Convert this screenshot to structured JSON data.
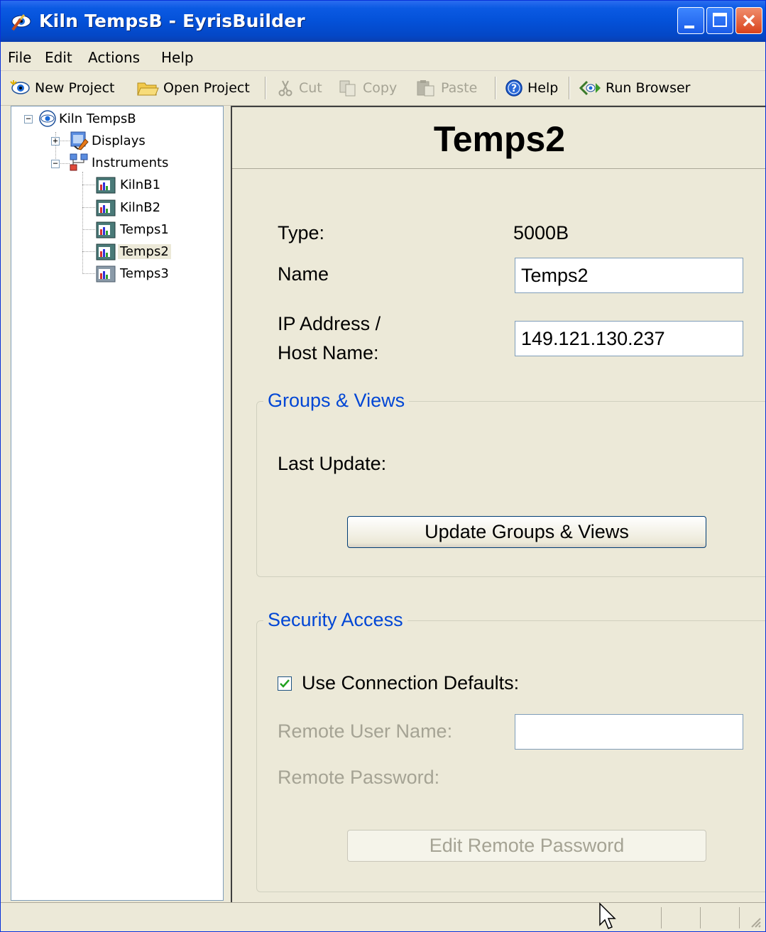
{
  "window": {
    "title": "Kiln TempsB - EyrisBuilder",
    "icon": "eyris-app-icon",
    "controls": [
      "minimize-icon",
      "maximize-icon",
      "close-icon"
    ]
  },
  "menu": {
    "file": "File",
    "edit": "Edit",
    "actions": "Actions",
    "help": "Help"
  },
  "toolbar": {
    "new_project": "New Project",
    "open_project": "Open Project",
    "cut": "Cut",
    "copy": "Copy",
    "paste": "Paste",
    "help": "Help",
    "run_browser": "Run Browser"
  },
  "tree": {
    "root": "Kiln TempsB",
    "displays": "Displays",
    "instruments": "Instruments",
    "items": [
      "KilnB1",
      "KilnB2",
      "Temps1",
      "Temps2",
      "Temps3"
    ],
    "selected": "Temps2"
  },
  "detail": {
    "heading": "Temps2",
    "type_label": "Type:",
    "type_value": "5000B",
    "name_label": "Name",
    "name_value": "Temps2",
    "ip_label_line1": "IP Address /",
    "ip_label_line2": "Host Name:",
    "ip_value": "149.121.130.237"
  },
  "groups_views": {
    "title": "Groups & Views",
    "last_update_label": "Last Update:",
    "update_button": "Update Groups & Views"
  },
  "security": {
    "title": "Security Access",
    "use_defaults_label": "Use Connection Defaults:",
    "use_defaults_checked": true,
    "remote_user_label": "Remote User Name:",
    "remote_user_value": "",
    "remote_password_label": "Remote Password:",
    "edit_password_button": "Edit Remote Password"
  },
  "colors": {
    "titlebar": "#0451d8",
    "group_title": "#0046d5",
    "disabled_text": "#a5a394",
    "face": "#ece9d8"
  }
}
